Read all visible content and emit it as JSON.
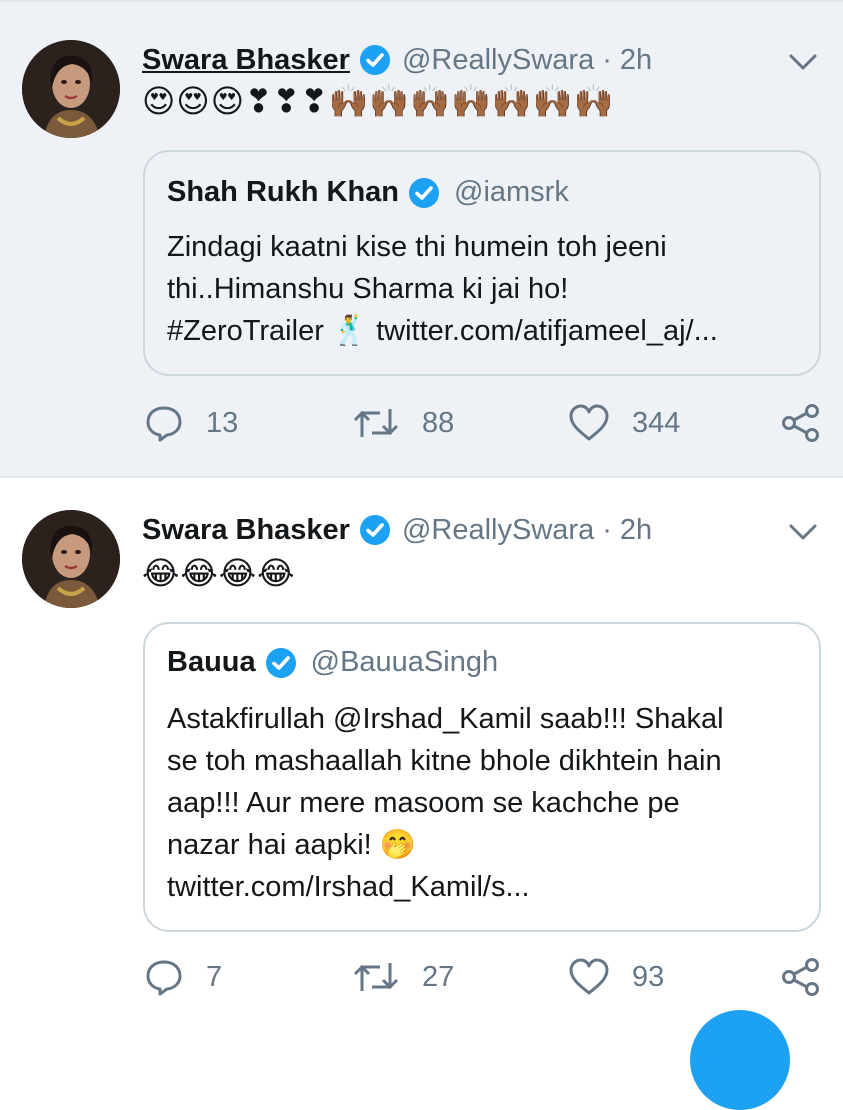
{
  "colors": {
    "accent": "#1da1f2",
    "muted": "#657786",
    "border": "#ccd6dd",
    "highlight_background": "#eef2f6"
  },
  "tweets": [
    {
      "name": "Swara Bhasker",
      "handle": "@ReallySwara",
      "separator": "·",
      "time": "2h",
      "emojis": "😍😍😍❣❣❣🙌🏾🙌🏾🙌🏾🙌🏾🙌🏾🙌🏾🙌🏾",
      "quoted": {
        "name": "Shah Rukh Khan",
        "handle": "@iamsrk",
        "text_lines": [
          "Zindagi kaatni kise thi humein toh jeeni",
          "thi..Himanshu Sharma ki jai ho!",
          "#ZeroTrailer 🕺  twitter.com/atifjameel_aj/..."
        ]
      },
      "replies": "13",
      "retweets": "88",
      "likes": "344"
    },
    {
      "name": "Swara Bhasker",
      "handle": "@ReallySwara",
      "separator": "·",
      "time": "2h",
      "emojis": "😂😂😂😂",
      "quoted": {
        "name": "Bauua",
        "handle": "@BauuaSingh",
        "text_lines": [
          "Astakfirullah @Irshad_Kamil saab!!! Shakal",
          "se toh mashaallah kitne bhole dikhtein hain",
          "aap!!! Aur mere masoom se kachche pe",
          "nazar hai aapki! 🤭",
          "twitter.com/Irshad_Kamil/s..."
        ]
      },
      "replies": "7",
      "retweets": "27",
      "likes": "93"
    }
  ]
}
